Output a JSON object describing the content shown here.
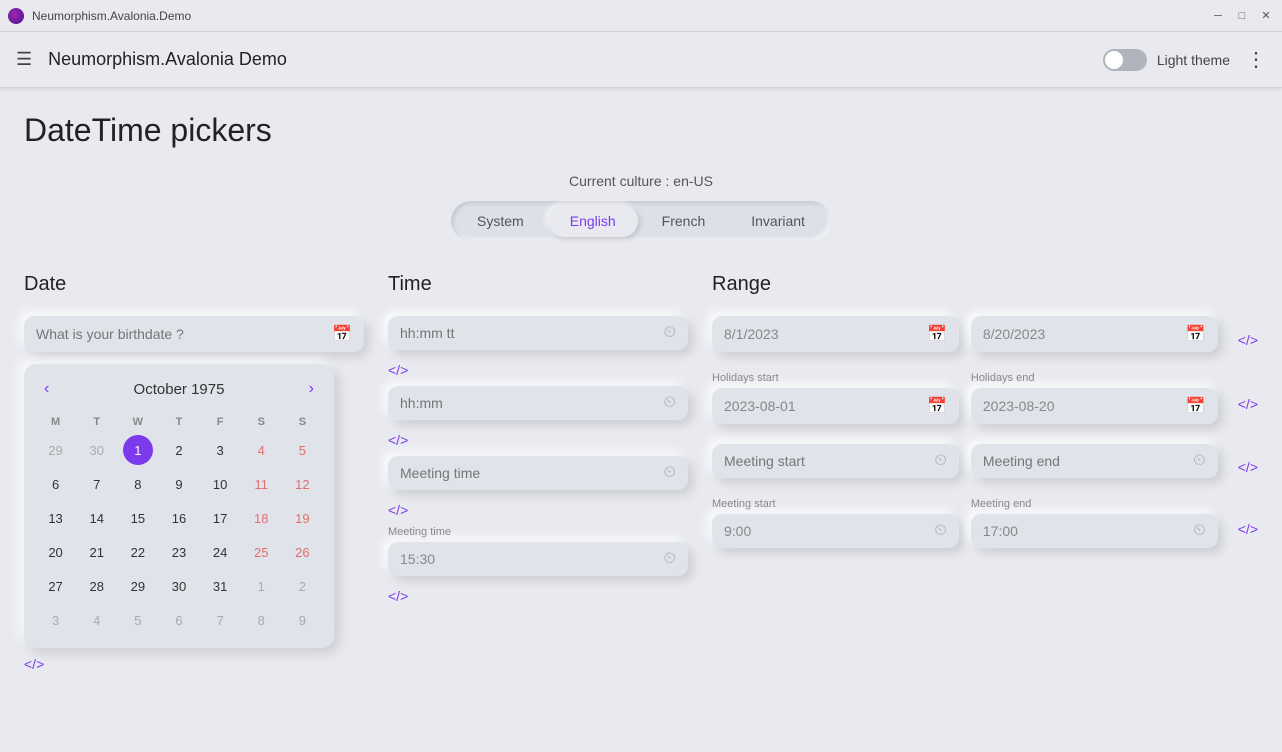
{
  "window": {
    "title": "Neumorphism.Avalonia.Demo",
    "controls": {
      "minimize": "─",
      "maximize": "□",
      "close": "✕"
    }
  },
  "topbar": {
    "menu_icon": "☰",
    "app_title": "Neumorphism.Avalonia Demo",
    "theme_label": "Light theme",
    "more_icon": "⋮"
  },
  "page": {
    "title": "DateTime pickers"
  },
  "culture": {
    "label": "Current culture : en-US",
    "tabs": [
      {
        "id": "system",
        "label": "System"
      },
      {
        "id": "english",
        "label": "English"
      },
      {
        "id": "french",
        "label": "French"
      },
      {
        "id": "invariant",
        "label": "Invariant"
      }
    ],
    "active_tab": "english"
  },
  "date_section": {
    "title": "Date",
    "input_placeholder": "What is your birthdate ?",
    "calendar_icon": "📅",
    "month_year": "October 1975",
    "prev_icon": "‹",
    "next_icon": "›",
    "day_headers": [
      "M",
      "T",
      "W",
      "T",
      "F",
      "S",
      "S"
    ],
    "weeks": [
      [
        {
          "day": "29",
          "type": "other"
        },
        {
          "day": "30",
          "type": "other"
        },
        {
          "day": "1",
          "type": "selected"
        },
        {
          "day": "2",
          "type": "normal"
        },
        {
          "day": "3",
          "type": "normal"
        },
        {
          "day": "4",
          "type": "weekend"
        },
        {
          "day": "5",
          "type": "weekend"
        }
      ],
      [
        {
          "day": "6",
          "type": "normal"
        },
        {
          "day": "7",
          "type": "normal"
        },
        {
          "day": "8",
          "type": "normal"
        },
        {
          "day": "9",
          "type": "normal"
        },
        {
          "day": "10",
          "type": "normal"
        },
        {
          "day": "11",
          "type": "highlight"
        },
        {
          "day": "12",
          "type": "weekend"
        }
      ],
      [
        {
          "day": "13",
          "type": "normal"
        },
        {
          "day": "14",
          "type": "normal"
        },
        {
          "day": "15",
          "type": "normal"
        },
        {
          "day": "16",
          "type": "normal"
        },
        {
          "day": "17",
          "type": "normal"
        },
        {
          "day": "18",
          "type": "highlight"
        },
        {
          "day": "19",
          "type": "weekend"
        }
      ],
      [
        {
          "day": "20",
          "type": "normal"
        },
        {
          "day": "21",
          "type": "normal"
        },
        {
          "day": "22",
          "type": "normal"
        },
        {
          "day": "23",
          "type": "normal"
        },
        {
          "day": "24",
          "type": "normal"
        },
        {
          "day": "25",
          "type": "weekend"
        },
        {
          "day": "26",
          "type": "weekend"
        }
      ],
      [
        {
          "day": "27",
          "type": "normal"
        },
        {
          "day": "28",
          "type": "normal"
        },
        {
          "day": "29",
          "type": "normal"
        },
        {
          "day": "30",
          "type": "normal"
        },
        {
          "day": "31",
          "type": "normal"
        },
        {
          "day": "1",
          "type": "other"
        },
        {
          "day": "2",
          "type": "other"
        }
      ],
      [
        {
          "day": "3",
          "type": "other"
        },
        {
          "day": "4",
          "type": "other"
        },
        {
          "day": "5",
          "type": "other"
        },
        {
          "day": "6",
          "type": "other"
        },
        {
          "day": "7",
          "type": "other"
        },
        {
          "day": "8",
          "type": "other"
        },
        {
          "day": "9",
          "type": "other"
        }
      ]
    ],
    "code_toggle": "<>"
  },
  "time_section": {
    "title": "Time",
    "inputs": [
      {
        "placeholder": "hh:mm tt",
        "has_clock": true
      },
      {
        "placeholder": "hh:mm",
        "has_clock": true
      },
      {
        "placeholder": "Meeting time",
        "has_clock": true
      }
    ],
    "meeting_time_label": "Meeting time",
    "meeting_time_value": "15:30",
    "code_toggles": [
      "<>",
      "<>",
      "<>",
      "<>"
    ]
  },
  "range_section": {
    "title": "Range",
    "date_start": "8/1/2023",
    "date_end": "8/20/2023",
    "holidays_start_label": "Holidays start",
    "holidays_start_value": "2023-08-01",
    "holidays_end_label": "Holidays end",
    "holidays_end_value": "2023-08-20",
    "meeting_start_label": "Meeting start",
    "meeting_start_placeholder": "Meeting start",
    "meeting_end_label": "Meeting end",
    "meeting_end_placeholder": "Meeting end",
    "meeting_start_time_label": "Meeting start",
    "meeting_start_time_value": "9:00",
    "meeting_end_time_label": "Meeting end",
    "meeting_end_time_value": "17:00",
    "clock_icon": "🕐",
    "calendar_icon": "📅",
    "code_toggle": "<>"
  }
}
